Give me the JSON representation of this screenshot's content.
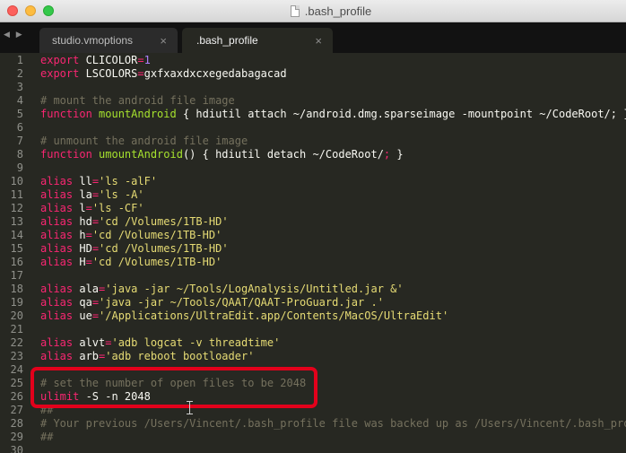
{
  "window": {
    "title": ".bash_profile",
    "doc_icon": "document-icon"
  },
  "tabs": [
    {
      "label": "studio.vmoptions",
      "active": false,
      "close": "×"
    },
    {
      "label": ".bash_profile",
      "active": true,
      "close": "×"
    }
  ],
  "nav_arrows": "◀ ▶",
  "editor": {
    "lines": [
      {
        "n": "1",
        "tokens": [
          [
            "kw",
            "export"
          ],
          [
            "txt",
            " CLICOLOR"
          ],
          [
            "kw",
            "="
          ],
          [
            "num",
            "1"
          ]
        ]
      },
      {
        "n": "2",
        "tokens": [
          [
            "kw",
            "export"
          ],
          [
            "txt",
            " LSCOLORS"
          ],
          [
            "kw",
            "="
          ],
          [
            "txt",
            "gxfxaxdxcxegedabagacad"
          ]
        ]
      },
      {
        "n": "3",
        "tokens": []
      },
      {
        "n": "4",
        "tokens": [
          [
            "cmt",
            "# mount the android file image"
          ]
        ]
      },
      {
        "n": "5",
        "tokens": [
          [
            "kw",
            "function"
          ],
          [
            "fn",
            " mountAndroid"
          ],
          [
            "txt",
            " { hdiutil attach ~/android.dmg.sparseimage -mountpoint ~/CodeRoot/; }"
          ]
        ]
      },
      {
        "n": "6",
        "tokens": []
      },
      {
        "n": "7",
        "tokens": [
          [
            "cmt",
            "# unmount the android file image"
          ]
        ]
      },
      {
        "n": "8",
        "tokens": [
          [
            "kw",
            "function"
          ],
          [
            "fn",
            " umountAndroid"
          ],
          [
            "txt",
            "() { hdiutil detach ~/CodeRoot/"
          ],
          [
            "kw",
            ";"
          ],
          [
            "txt",
            " }"
          ]
        ]
      },
      {
        "n": "9",
        "tokens": []
      },
      {
        "n": "10",
        "tokens": [
          [
            "kw",
            "alias"
          ],
          [
            "txt",
            " ll"
          ],
          [
            "kw",
            "="
          ],
          [
            "str",
            "'ls -alF'"
          ]
        ]
      },
      {
        "n": "11",
        "tokens": [
          [
            "kw",
            "alias"
          ],
          [
            "txt",
            " la"
          ],
          [
            "kw",
            "="
          ],
          [
            "str",
            "'ls -A'"
          ]
        ]
      },
      {
        "n": "12",
        "tokens": [
          [
            "kw",
            "alias"
          ],
          [
            "txt",
            " l"
          ],
          [
            "kw",
            "="
          ],
          [
            "str",
            "'ls -CF'"
          ]
        ]
      },
      {
        "n": "13",
        "tokens": [
          [
            "kw",
            "alias"
          ],
          [
            "txt",
            " hd"
          ],
          [
            "kw",
            "="
          ],
          [
            "str",
            "'cd /Volumes/1TB-HD'"
          ]
        ]
      },
      {
        "n": "14",
        "tokens": [
          [
            "kw",
            "alias"
          ],
          [
            "txt",
            " h"
          ],
          [
            "kw",
            "="
          ],
          [
            "str",
            "'cd /Volumes/1TB-HD'"
          ]
        ]
      },
      {
        "n": "15",
        "tokens": [
          [
            "kw",
            "alias"
          ],
          [
            "txt",
            " HD"
          ],
          [
            "kw",
            "="
          ],
          [
            "str",
            "'cd /Volumes/1TB-HD'"
          ]
        ]
      },
      {
        "n": "16",
        "tokens": [
          [
            "kw",
            "alias"
          ],
          [
            "txt",
            " H"
          ],
          [
            "kw",
            "="
          ],
          [
            "str",
            "'cd /Volumes/1TB-HD'"
          ]
        ]
      },
      {
        "n": "17",
        "tokens": []
      },
      {
        "n": "18",
        "tokens": [
          [
            "kw",
            "alias"
          ],
          [
            "txt",
            " ala"
          ],
          [
            "kw",
            "="
          ],
          [
            "str",
            "'java -jar ~/Tools/LogAnalysis/Untitled.jar &'"
          ]
        ]
      },
      {
        "n": "19",
        "tokens": [
          [
            "kw",
            "alias"
          ],
          [
            "txt",
            " qa"
          ],
          [
            "kw",
            "="
          ],
          [
            "str",
            "'java -jar ~/Tools/QAAT/QAAT-ProGuard.jar .'"
          ]
        ]
      },
      {
        "n": "20",
        "tokens": [
          [
            "kw",
            "alias"
          ],
          [
            "txt",
            " ue"
          ],
          [
            "kw",
            "="
          ],
          [
            "str",
            "'/Applications/UltraEdit.app/Contents/MacOS/UltraEdit'"
          ]
        ]
      },
      {
        "n": "21",
        "tokens": []
      },
      {
        "n": "22",
        "tokens": [
          [
            "kw",
            "alias"
          ],
          [
            "txt",
            " alvt"
          ],
          [
            "kw",
            "="
          ],
          [
            "str",
            "'adb logcat -v threadtime'"
          ]
        ]
      },
      {
        "n": "23",
        "tokens": [
          [
            "kw",
            "alias"
          ],
          [
            "txt",
            " arb"
          ],
          [
            "kw",
            "="
          ],
          [
            "str",
            "'adb reboot bootloader'"
          ]
        ]
      },
      {
        "n": "24",
        "tokens": []
      },
      {
        "n": "25",
        "tokens": [
          [
            "cmt",
            "# set the number of open files to be 2048"
          ]
        ]
      },
      {
        "n": "26",
        "tokens": [
          [
            "kw",
            "ulimit"
          ],
          [
            "txt",
            " -S -n 2048"
          ]
        ]
      },
      {
        "n": "27",
        "tokens": [
          [
            "cmt",
            "##"
          ]
        ]
      },
      {
        "n": "28",
        "tokens": [
          [
            "cmt",
            "# Your previous /Users/Vincent/.bash_profile file was backed up as /Users/Vincent/.bash_profile"
          ]
        ]
      },
      {
        "n": "29",
        "tokens": [
          [
            "cmt",
            "##"
          ]
        ]
      },
      {
        "n": "30",
        "tokens": []
      }
    ]
  },
  "colors": {
    "background": "#272822",
    "keyword": "#f92672",
    "function": "#a6e22e",
    "string": "#e6db74",
    "comment": "#75715e",
    "number": "#ae81ff",
    "highlight_border": "#e3001b"
  }
}
